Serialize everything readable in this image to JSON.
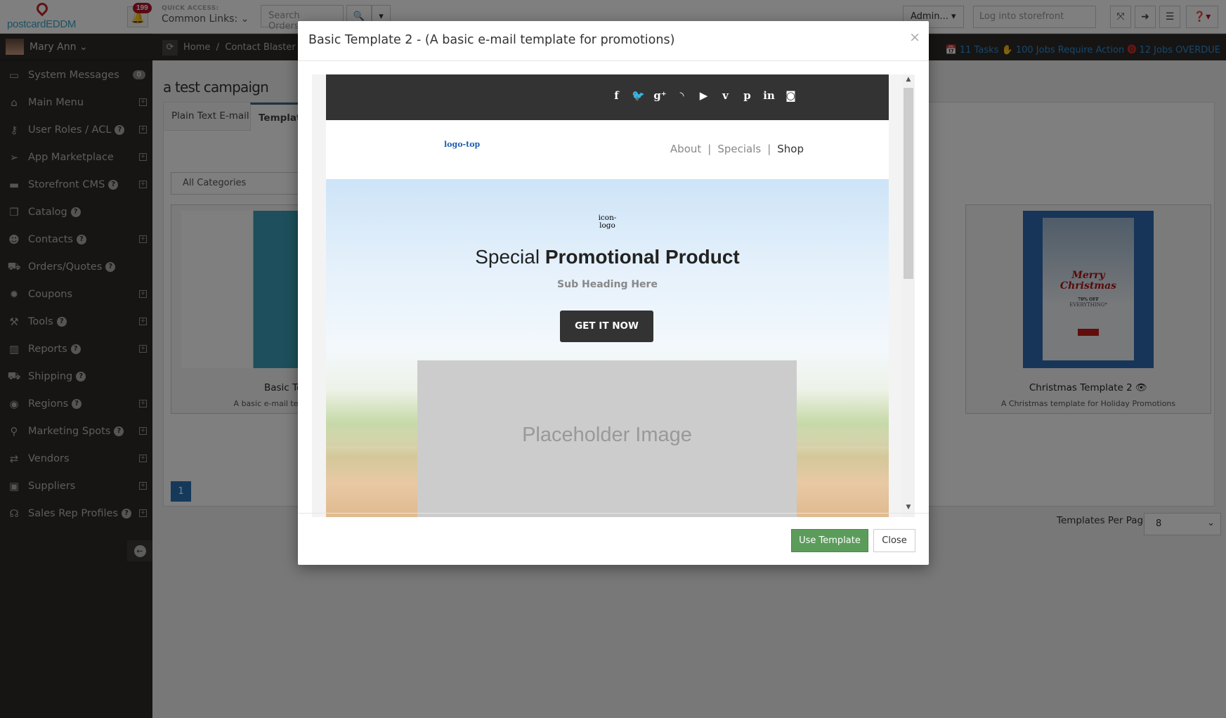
{
  "app": {
    "brand": "postcardEDDM"
  },
  "topbar": {
    "notifications_count": "199",
    "quick_access_label": "QUICK ACCESS:",
    "common_links_label": "Common Links:",
    "search_placeholder": "Search Orders/I",
    "admin_label": "Admin...",
    "storefront_placeholder": "Log into storefront"
  },
  "user": {
    "name": "Mary Ann"
  },
  "sidebar": {
    "items": [
      {
        "label": "System Messages",
        "icon": "inbox-icon",
        "glyph": "▭",
        "badge": "0",
        "help": false,
        "expand": false
      },
      {
        "label": "Main Menu",
        "icon": "home-icon",
        "glyph": "⌂",
        "help": false,
        "expand": true
      },
      {
        "label": "User Roles / ACL",
        "icon": "key-icon",
        "glyph": "⚷",
        "help": true,
        "expand": true
      },
      {
        "label": "App Marketplace",
        "icon": "paper-plane-icon",
        "glyph": "➢",
        "help": false,
        "expand": true
      },
      {
        "label": "Storefront CMS",
        "icon": "desktop-icon",
        "glyph": "▬",
        "help": true,
        "expand": true
      },
      {
        "label": "Catalog",
        "icon": "cubes-icon",
        "glyph": "❒",
        "help": true,
        "expand": false
      },
      {
        "label": "Contacts",
        "icon": "users-icon",
        "glyph": "☻",
        "help": true,
        "expand": true
      },
      {
        "label": "Orders/Quotes",
        "icon": "cart-icon",
        "glyph": "⛟",
        "help": true,
        "expand": false
      },
      {
        "label": "Coupons",
        "icon": "certificate-icon",
        "glyph": "✹",
        "help": false,
        "expand": true
      },
      {
        "label": "Tools",
        "icon": "wrench-icon",
        "glyph": "⚒",
        "help": true,
        "expand": true
      },
      {
        "label": "Reports",
        "icon": "bar-chart-icon",
        "glyph": "▥",
        "help": true,
        "expand": true
      },
      {
        "label": "Shipping",
        "icon": "truck-icon",
        "glyph": "⛟",
        "help": true,
        "expand": false
      },
      {
        "label": "Regions",
        "icon": "globe-icon",
        "glyph": "◉",
        "help": true,
        "expand": true
      },
      {
        "label": "Marketing Spots",
        "icon": "map-marker-icon",
        "glyph": "⚲",
        "help": true,
        "expand": true
      },
      {
        "label": "Vendors",
        "icon": "exchange-icon",
        "glyph": "⇄",
        "help": false,
        "expand": true
      },
      {
        "label": "Suppliers",
        "icon": "briefcase-icon",
        "glyph": "▣",
        "help": false,
        "expand": true
      },
      {
        "label": "Sales Rep Profiles",
        "icon": "headphones-icon",
        "glyph": "☊",
        "help": true,
        "expand": true
      }
    ]
  },
  "breadcrumb": {
    "home": "Home",
    "separator": "/",
    "current": "Contact Blaster C"
  },
  "alerts": {
    "tasks": "11 Tasks",
    "jobs_action": "100 Jobs Require Action",
    "jobs_overdue": "12 Jobs OVERDUE"
  },
  "page": {
    "title": "a test campaign",
    "tabs": [
      "Plain Text E-mail",
      "Templates"
    ],
    "category_select": "All Categories",
    "cards": [
      {
        "title": "Basic Temp",
        "desc": "A basic e-mail templa"
      },
      {
        "title": "Christmas Template 2",
        "desc": "A Christmas template for Holiday Promotions",
        "thumb_text1": "Merry",
        "thumb_text2": "Christmas",
        "thumb_text3": "70% OFF",
        "thumb_text4": "EVERYTHING*"
      }
    ],
    "current_page": "1",
    "templates_per_page_label": "Templates Per Page",
    "templates_per_page_value": "8"
  },
  "modal": {
    "title": "Basic Template 2 - (A basic e-mail template for promotions)",
    "close_glyph": "×",
    "use_template": "Use Template",
    "close": "Close",
    "preview": {
      "social_icons": [
        {
          "name": "facebook-icon",
          "glyph": "f"
        },
        {
          "name": "twitter-icon",
          "glyph": "🐦"
        },
        {
          "name": "google-plus-icon",
          "glyph": "g⁺"
        },
        {
          "name": "rss-icon",
          "glyph": "◝"
        },
        {
          "name": "youtube-icon",
          "glyph": "▶"
        },
        {
          "name": "vimeo-icon",
          "glyph": "v"
        },
        {
          "name": "pinterest-icon",
          "glyph": "p"
        },
        {
          "name": "linkedin-icon",
          "glyph": "in"
        },
        {
          "name": "instagram-icon",
          "glyph": "◙"
        }
      ],
      "logo_alt": "logo-top",
      "nav": [
        "About",
        "Specials",
        "Shop"
      ],
      "nav_separator": "|",
      "icon_logo_line1": "icon-",
      "icon_logo_line2": "logo",
      "heading_light": "Special ",
      "heading_bold": "Promotional Product",
      "subheading": "Sub Heading Here",
      "cta": "GET IT NOW",
      "placeholder": "Placeholder Image"
    }
  }
}
